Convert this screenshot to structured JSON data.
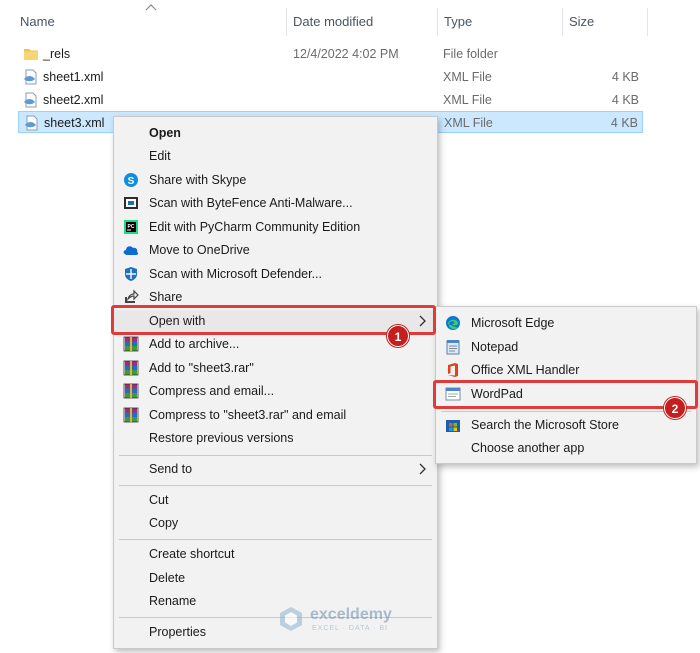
{
  "header": {
    "name": "Name",
    "date_modified": "Date modified",
    "type": "Type",
    "size": "Size"
  },
  "files": [
    {
      "name": "_rels",
      "date": "12/4/2022 4:02 PM",
      "type": "File folder",
      "size": ""
    },
    {
      "name": "sheet1.xml",
      "date": "",
      "type": "XML File",
      "size": "4 KB"
    },
    {
      "name": "sheet2.xml",
      "date": "",
      "type": "XML File",
      "size": "4 KB"
    },
    {
      "name": "sheet3.xml",
      "date": "",
      "type": "XML File",
      "size": "4 KB"
    }
  ],
  "context_menu": {
    "open": "Open",
    "edit": "Edit",
    "share_skype": "Share with Skype",
    "scan_bytefence": "Scan with ByteFence Anti-Malware...",
    "edit_pycharm": "Edit with PyCharm Community Edition",
    "move_onedrive": "Move to OneDrive",
    "scan_defender": "Scan with Microsoft Defender...",
    "share": "Share",
    "open_with": "Open with",
    "add_archive": "Add to archive...",
    "add_rar": "Add to \"sheet3.rar\"",
    "compress_email": "Compress and email...",
    "compress_rar_email": "Compress to \"sheet3.rar\" and email",
    "restore": "Restore previous versions",
    "send_to": "Send to",
    "cut": "Cut",
    "copy": "Copy",
    "create_shortcut": "Create shortcut",
    "delete": "Delete",
    "rename": "Rename",
    "properties": "Properties"
  },
  "open_with_menu": {
    "edge": "Microsoft Edge",
    "notepad": "Notepad",
    "office_xml": "Office XML Handler",
    "wordpad": "WordPad",
    "store": "Search the Microsoft Store",
    "choose": "Choose another app"
  },
  "badges": {
    "one": "1",
    "two": "2"
  },
  "watermark": {
    "title": "exceldemy",
    "subtitle": "EXCEL · DATA · BI"
  },
  "colors": {
    "highlight": "#e03a3a",
    "selection": "#cce8ff",
    "badge": "#c41f1f"
  }
}
